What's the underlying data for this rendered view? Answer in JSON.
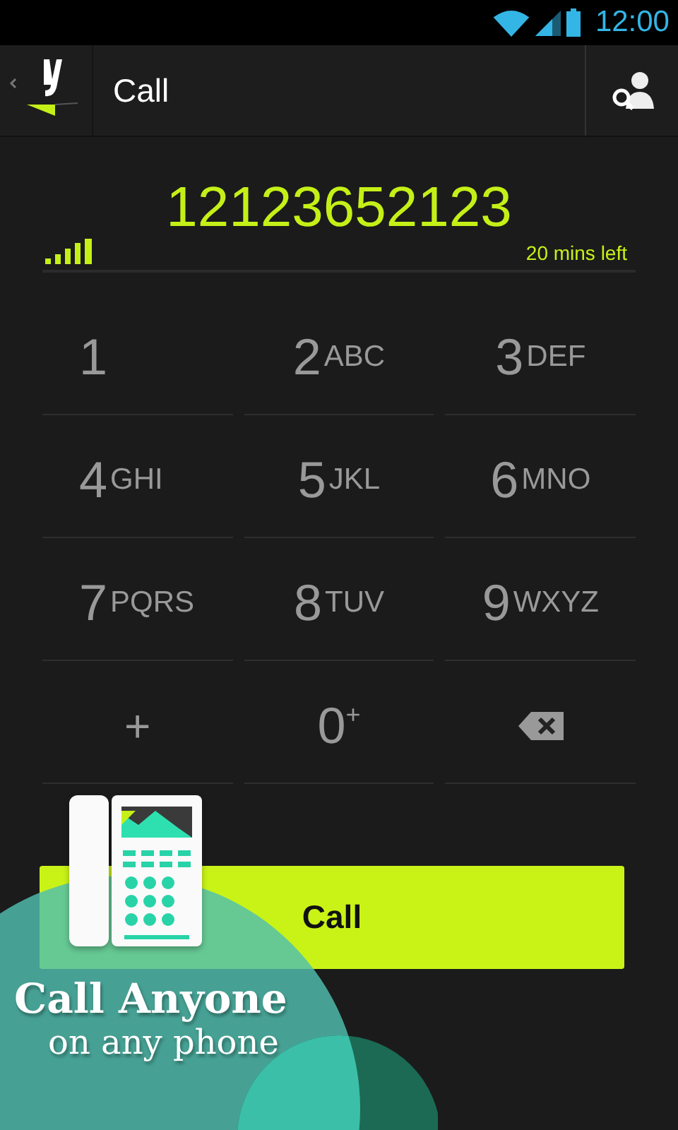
{
  "status_bar": {
    "time": "12:00"
  },
  "action_bar": {
    "title": "Call"
  },
  "dialer": {
    "number": "12123652123",
    "credit": "20 mins left"
  },
  "keys": [
    {
      "kind": "digit",
      "digit": "1"
    },
    {
      "kind": "digit",
      "digit": "2",
      "letters": "ABC"
    },
    {
      "kind": "digit",
      "digit": "3",
      "letters": "DEF"
    },
    {
      "kind": "digit",
      "digit": "4",
      "letters": "GHI"
    },
    {
      "kind": "digit",
      "digit": "5",
      "letters": "JKL"
    },
    {
      "kind": "digit",
      "digit": "6",
      "letters": "MNO"
    },
    {
      "kind": "digit",
      "digit": "7",
      "letters": "PQRS"
    },
    {
      "kind": "digit",
      "digit": "8",
      "letters": "TUV"
    },
    {
      "kind": "digit",
      "digit": "9",
      "letters": "WXYZ"
    },
    {
      "kind": "symbol",
      "digit": "+"
    },
    {
      "kind": "zero",
      "digit": "0",
      "sup": "+"
    },
    {
      "kind": "backspace"
    }
  ],
  "call_button": {
    "label": "Call"
  },
  "promo": {
    "headline": "Call Anyone",
    "subline": "on any phone"
  }
}
